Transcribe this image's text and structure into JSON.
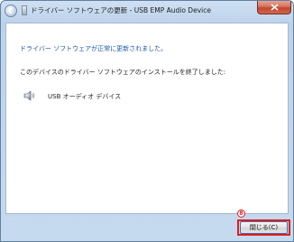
{
  "window": {
    "title": "ドライバー ソフトウェアの更新 - USB EMP Audio Device",
    "close_label": "×"
  },
  "content": {
    "heading": "ドライバー ソフトウェアが正常に更新されました。",
    "message": "このデバイスのドライバー ソフトウェアのインストールを終了しました:",
    "device_name": "USB オーディオ デバイス",
    "device_icon": "speaker-icon"
  },
  "footer": {
    "close_button_label": "閉じる(C)",
    "step_marker": "8"
  },
  "colors": {
    "heading": "#1d56a8",
    "highlight": "#e11c1c"
  }
}
